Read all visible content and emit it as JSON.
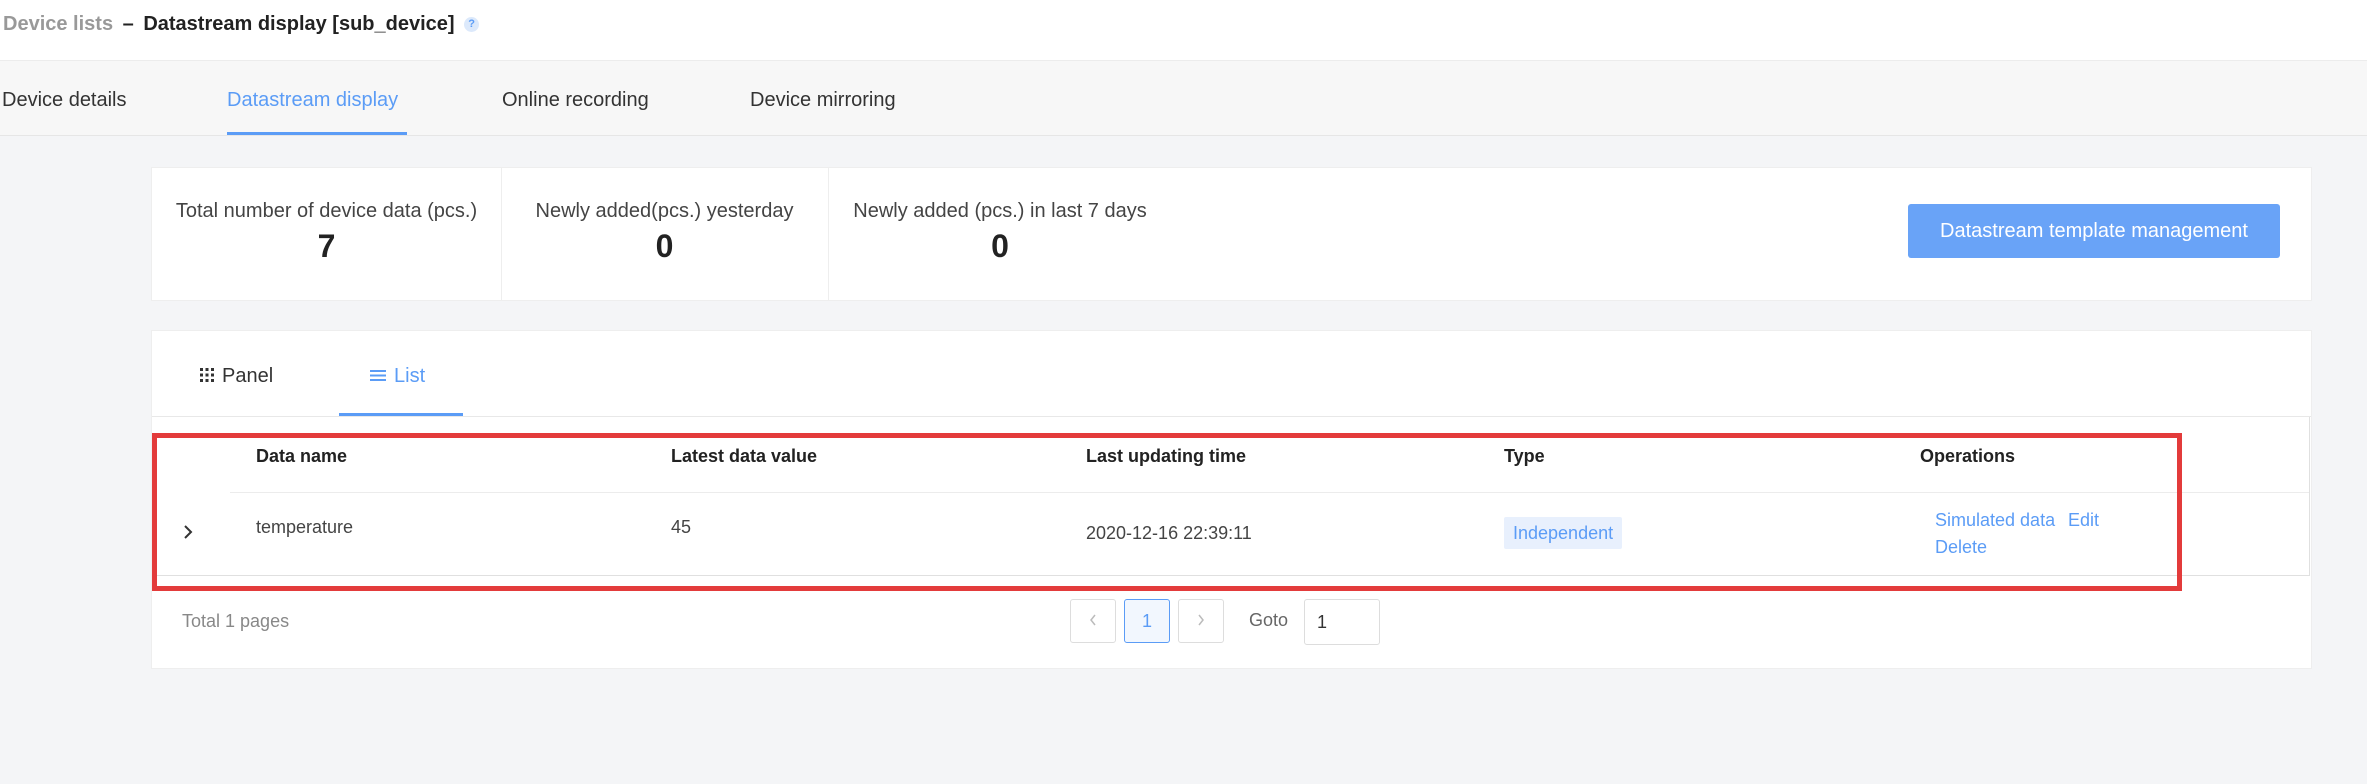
{
  "breadcrumb": {
    "parent": "Device lists",
    "separator": "–",
    "current": "Datastream display [sub_device]",
    "help": "?"
  },
  "top_tabs": [
    {
      "label": "Device details"
    },
    {
      "label": "Datastream display",
      "active": true
    },
    {
      "label": "Online recording"
    },
    {
      "label": "Device mirroring"
    }
  ],
  "stats": [
    {
      "label": "Total number of device data (pcs.)",
      "value": "7"
    },
    {
      "label": "Newly added(pcs.) yesterday",
      "value": "0"
    },
    {
      "label": "Newly added (pcs.) in last 7 days",
      "value": "0"
    }
  ],
  "template_button": "Datastream template management",
  "view_tabs": [
    {
      "label": "Panel",
      "icon": "grid-icon"
    },
    {
      "label": "List",
      "icon": "list-icon",
      "active": true
    }
  ],
  "table": {
    "columns": [
      "Data name",
      "Latest data value",
      "Last updating time",
      "Type",
      "Operations"
    ],
    "rows": [
      {
        "name": "temperature",
        "value": "45",
        "time": "2020-12-16 22:39:11",
        "type": "Independent",
        "ops": [
          "Simulated data",
          "Edit",
          "Delete"
        ]
      }
    ]
  },
  "pagination": {
    "total_text": "Total 1 pages",
    "current_page": "1",
    "goto_label": "Goto",
    "goto_value": "1"
  },
  "colors": {
    "accent": "#5b9cf6",
    "button": "#69a3f7",
    "highlight": "#e33b3b"
  }
}
